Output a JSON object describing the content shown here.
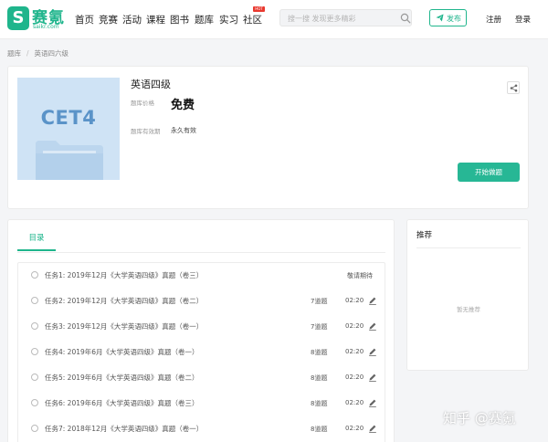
{
  "brand": {
    "name": "赛氪",
    "domain": "saikr.com",
    "mark": "S",
    "accent": "#1fb58c"
  },
  "nav": {
    "items": [
      "首页",
      "竞赛",
      "活动",
      "课程",
      "图书",
      "题库",
      "实习",
      "社区"
    ],
    "hot_badge": "HOT",
    "search_placeholder": "搜一搜 发现更多精彩",
    "publish_label": "发布",
    "register_label": "注册",
    "login_label": "登录"
  },
  "breadcrumb": [
    "题库",
    "英语四六级"
  ],
  "question_bank": {
    "cover_text": "CET4",
    "title": "英语四级",
    "price_label": "题库价格",
    "price": "免费",
    "validity_label": "题库有效期",
    "validity": "永久有效",
    "start_label": "开始做题"
  },
  "catalog": {
    "tab": "目录",
    "tasks": [
      {
        "name": "任务1:  2019年12月《大学英语四级》真题（卷三）",
        "count": "",
        "time": "",
        "status": "敬请期待"
      },
      {
        "name": "任务2:  2019年12月《大学英语四级》真题（卷二）",
        "count": "7道题",
        "time": "02:20",
        "status": ""
      },
      {
        "name": "任务3:  2019年12月《大学英语四级》真题（卷一）",
        "count": "7道题",
        "time": "02:20",
        "status": ""
      },
      {
        "name": "任务4:  2019年6月《大学英语四级》真题（卷一）",
        "count": "8道题",
        "time": "02:20",
        "status": ""
      },
      {
        "name": "任务5:  2019年6月《大学英语四级》真题（卷二）",
        "count": "8道题",
        "time": "02:20",
        "status": ""
      },
      {
        "name": "任务6:  2019年6月《大学英语四级》真题（卷三）",
        "count": "8道题",
        "time": "02:20",
        "status": ""
      },
      {
        "name": "任务7:  2018年12月《大学英语四级》真题（卷一）",
        "count": "8道题",
        "time": "02:20",
        "status": ""
      }
    ]
  },
  "recommend": {
    "title": "推荐",
    "empty": "暂无推荐"
  },
  "watermark": "知乎 @赛氪"
}
